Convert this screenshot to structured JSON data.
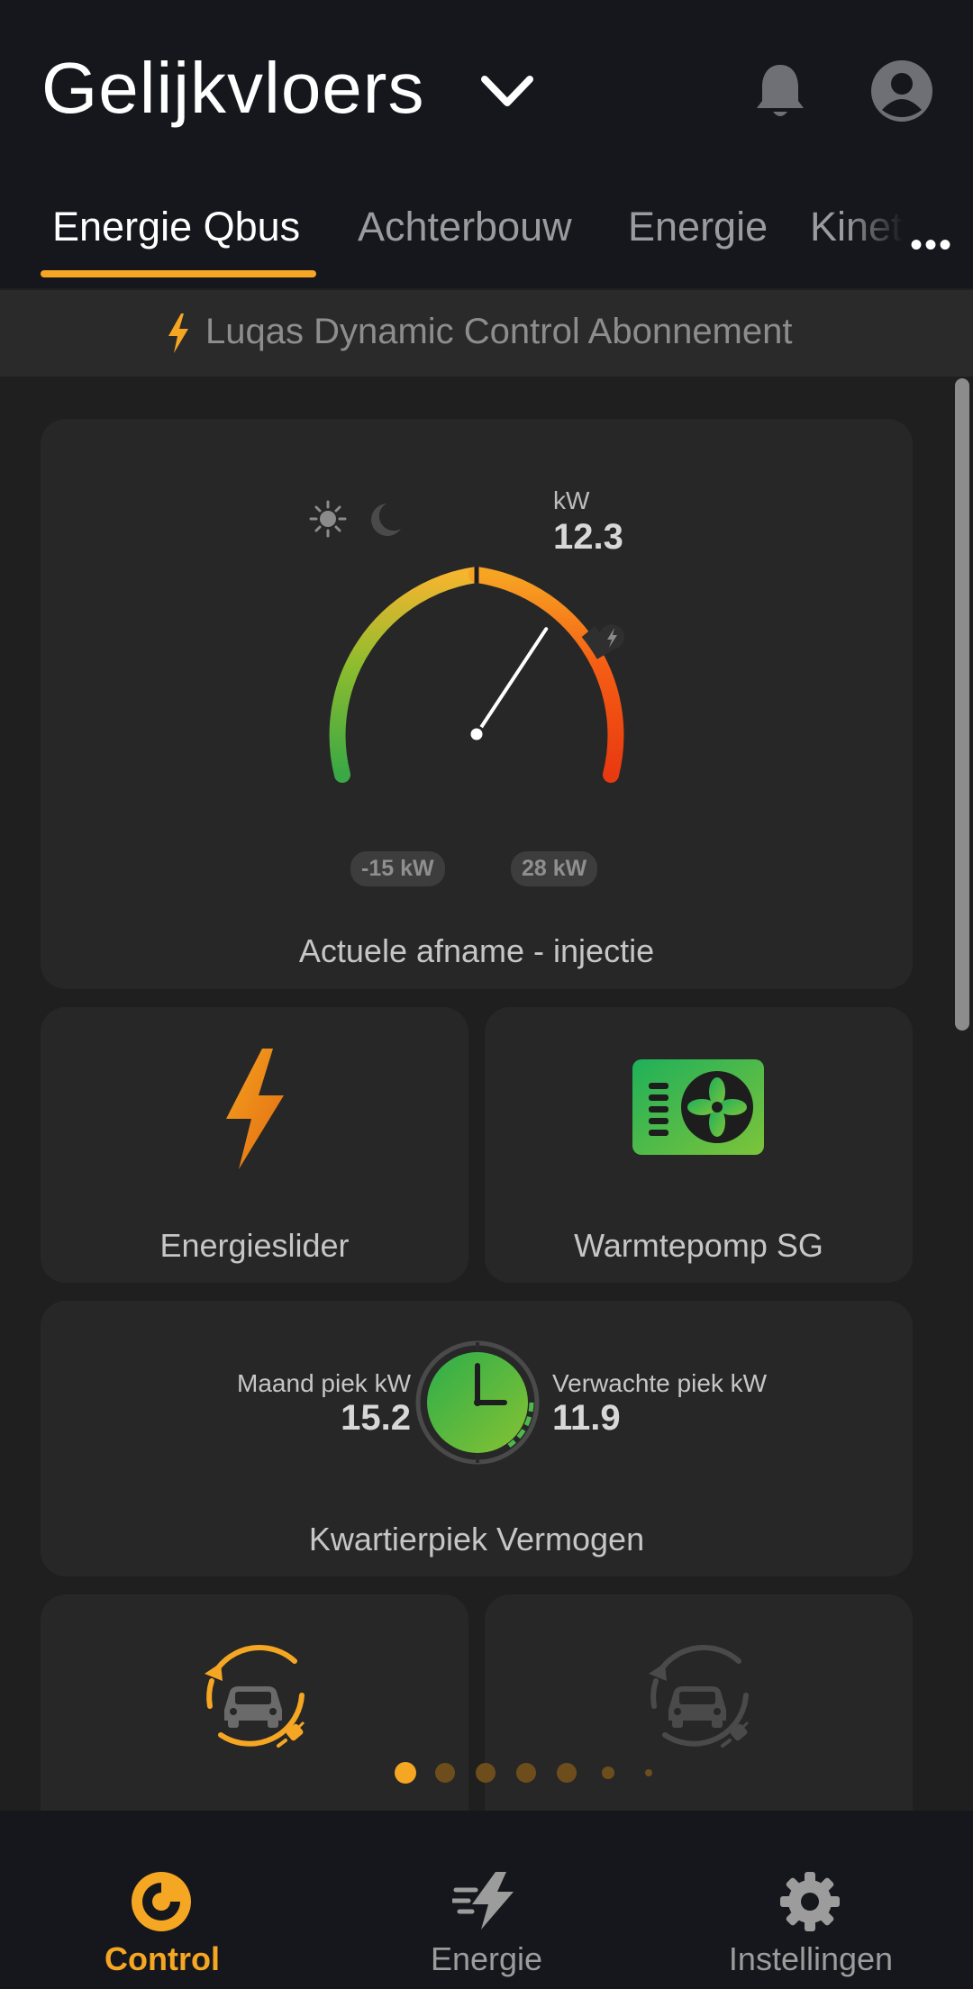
{
  "header": {
    "title": "Gelijkvloers"
  },
  "tabs": [
    {
      "label": "Energie Qbus"
    },
    {
      "label": "Achterbouw"
    },
    {
      "label": "Energie"
    },
    {
      "label": "Kinet"
    }
  ],
  "banner": {
    "text": "Luqas Dynamic Control Abonnement"
  },
  "gauge": {
    "unit": "kW",
    "value": "12.3",
    "min_label": "-15 kW",
    "max_label": "28 kW",
    "label": "Actuele afname - injectie",
    "min": -15,
    "max": 28,
    "current": 12.3
  },
  "tiles": {
    "energieslider": {
      "label": "Energieslider"
    },
    "warmtepomp": {
      "label": "Warmtepomp SG"
    }
  },
  "peak": {
    "month_label": "Maand piek kW",
    "month_value": "15.2",
    "expected_label": "Verwachte piek kW",
    "expected_value": "11.9",
    "label": "Kwartierpiek Vermogen"
  },
  "pager": {
    "count": 7,
    "active": 0
  },
  "bottom_nav": [
    {
      "label": "Control",
      "icon": "control-icon"
    },
    {
      "label": "Energie",
      "icon": "energy-bolt-icon"
    },
    {
      "label": "Instellingen",
      "icon": "gear-icon"
    }
  ],
  "colors": {
    "accent": "#f5a623",
    "header_bg": "#16171c",
    "card_bg": "#272727"
  }
}
